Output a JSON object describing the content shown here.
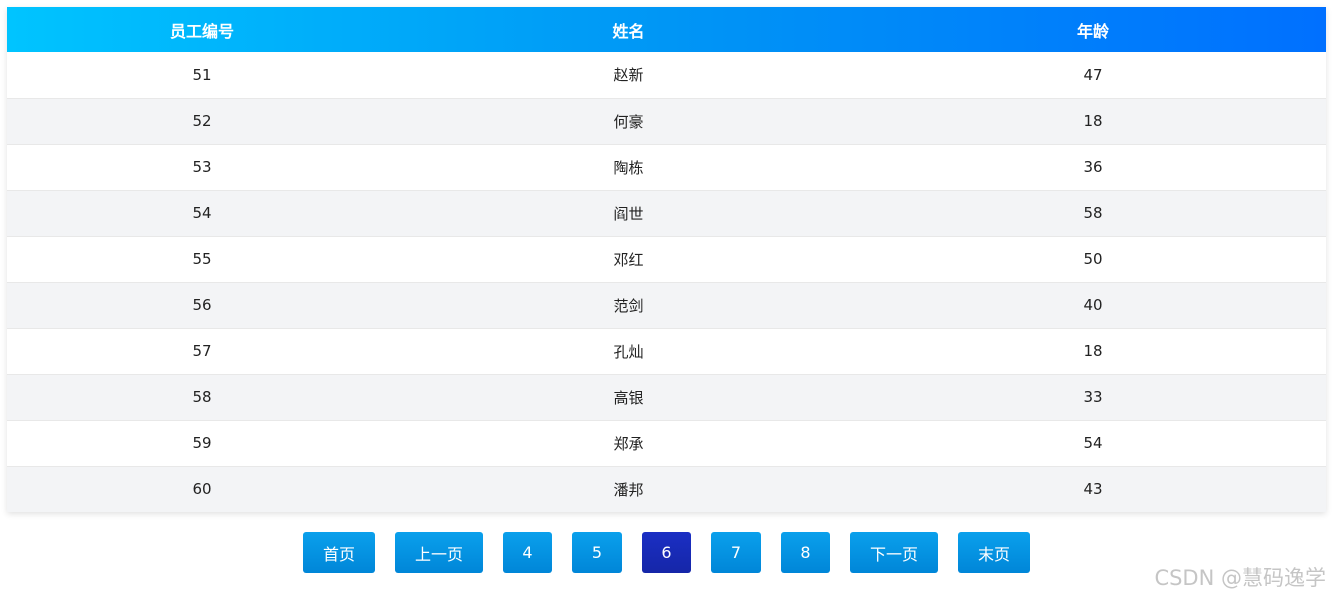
{
  "table": {
    "headers": [
      "员工编号",
      "姓名",
      "年龄"
    ],
    "rows": [
      [
        "51",
        "赵新",
        "47"
      ],
      [
        "52",
        "何豪",
        "18"
      ],
      [
        "53",
        "陶栋",
        "36"
      ],
      [
        "54",
        "阎世",
        "58"
      ],
      [
        "55",
        "邓红",
        "50"
      ],
      [
        "56",
        "范剑",
        "40"
      ],
      [
        "57",
        "孔灿",
        "18"
      ],
      [
        "58",
        "高银",
        "33"
      ],
      [
        "59",
        "郑承",
        "54"
      ],
      [
        "60",
        "潘邦",
        "43"
      ]
    ]
  },
  "pagination": {
    "first_label": "首页",
    "prev_label": "上一页",
    "pages": [
      "4",
      "5",
      "6",
      "7",
      "8"
    ],
    "current_page": "6",
    "next_label": "下一页",
    "last_label": "末页"
  },
  "watermark": "CSDN @慧码逸学",
  "colors": {
    "header_start": "#00c4ff",
    "header_end": "#0070ff",
    "button": "#0096e6",
    "button_active": "#1b2fc4",
    "row_alt": "#f3f4f6"
  }
}
